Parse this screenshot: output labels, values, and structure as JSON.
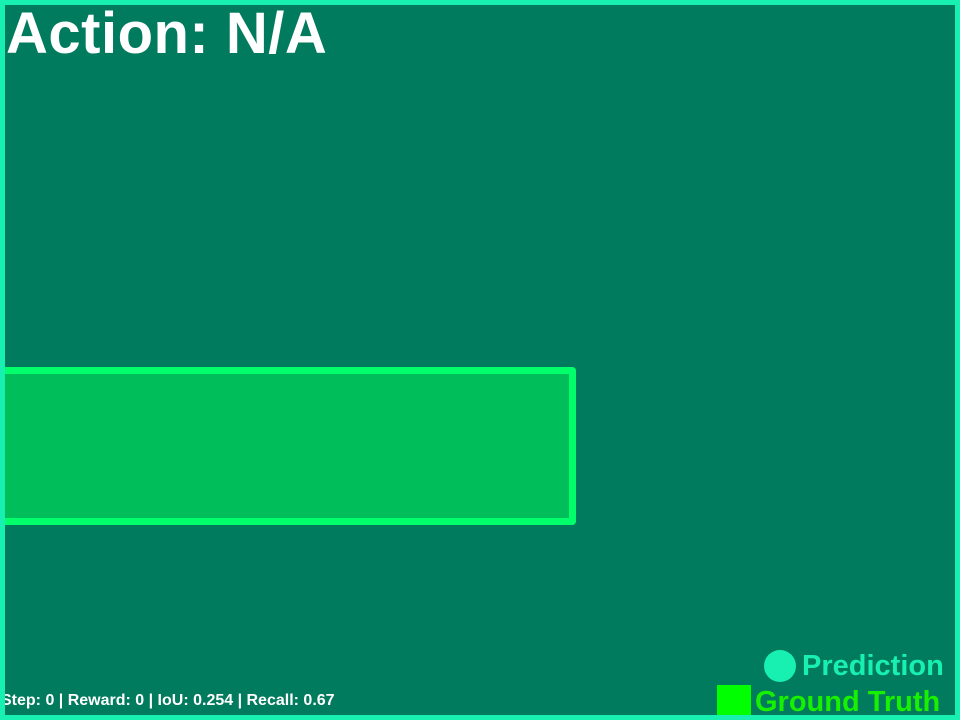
{
  "title": "Action: N/A",
  "stats_line": "Step: 0 | Reward: 0 | IoU: 0.254 | Recall: 0.67",
  "legend": {
    "prediction": {
      "label": "Prediction",
      "marker": "filled-circle-icon",
      "color": "#17f0b0"
    },
    "ground_truth": {
      "label": "Ground Truth",
      "marker": "filled-square-icon",
      "color": "#00ff00"
    }
  },
  "colors": {
    "background": "#007b5e",
    "frame_border": "#17f0b0",
    "ground_truth_fill": "#00bf5a",
    "ground_truth_outline": "#00ff6a",
    "text": "#ffffff"
  }
}
